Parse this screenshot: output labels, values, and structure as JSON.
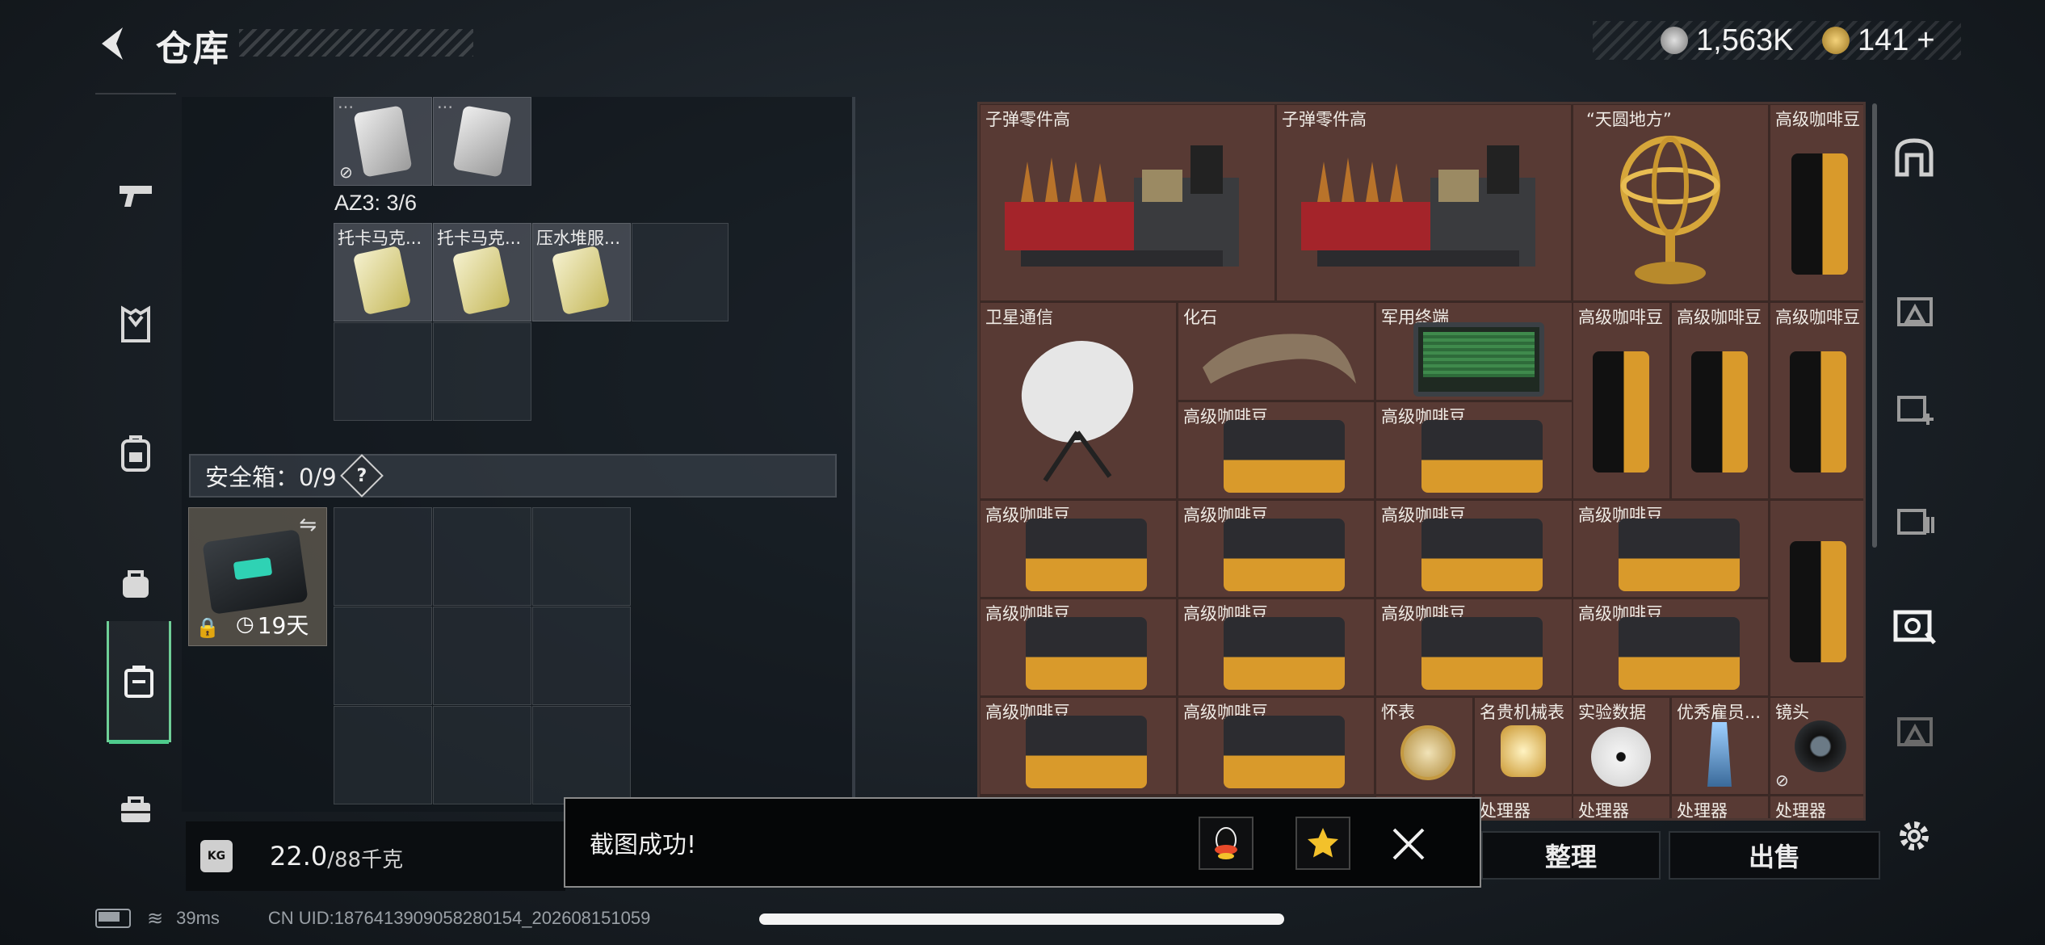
{
  "header": {
    "title": "仓库",
    "currency_1": "1,563K",
    "currency_2": "141",
    "add_symbol": "+"
  },
  "left_nav": [
    "weapon-icon",
    "armor-icon",
    "backpack-icon",
    "bag-icon",
    "safe-box-icon",
    "toolbox-icon"
  ],
  "left_panel": {
    "top_row_labels": [
      "...",
      "..."
    ],
    "az3_label": "AZ3: 3/6",
    "row_labels": [
      "托卡马克...",
      "托卡马克...",
      "压水堆服..."
    ],
    "safe_box_label": "安全箱：0/9",
    "safe_help": "?",
    "safe_timer": "19天",
    "weight_value": "22.0",
    "weight_max": "/88千克",
    "weight_icon": "KG"
  },
  "storage_items": {
    "r0": [
      "子弹零件高",
      "子弹零件高",
      "“天圆地方”",
      "高级咖啡豆"
    ],
    "r1": [
      "卫星通信",
      "化石",
      "军用终端",
      "高级咖啡豆",
      "高级咖啡豆",
      "高级咖啡豆"
    ],
    "r2": [
      "高级咖啡豆",
      "高级咖啡豆"
    ],
    "r3": [
      "高级咖啡豆",
      "高级咖啡豆",
      "高级咖啡豆",
      "高级咖啡豆"
    ],
    "r4": [
      "高级咖啡豆",
      "高级咖啡豆",
      "高级咖啡豆",
      "高级咖啡豆"
    ],
    "r5": [
      "高级咖啡豆",
      "高级咖啡豆",
      "怀表",
      "名贵机械表",
      "实验数据",
      "优秀雇员...",
      "镜头"
    ],
    "r6": [
      "处理器",
      "处理器",
      "处理器",
      "处理器"
    ]
  },
  "buttons": {
    "sort": "整理",
    "sell": "出售"
  },
  "toast": {
    "text": "截图成功!"
  },
  "status": {
    "ping": "39ms",
    "uid": "CN UID:1876413909058280154_202608151059"
  },
  "colors": {
    "accent_green": "#4ecb8c",
    "storage_bg": "#583a34"
  }
}
